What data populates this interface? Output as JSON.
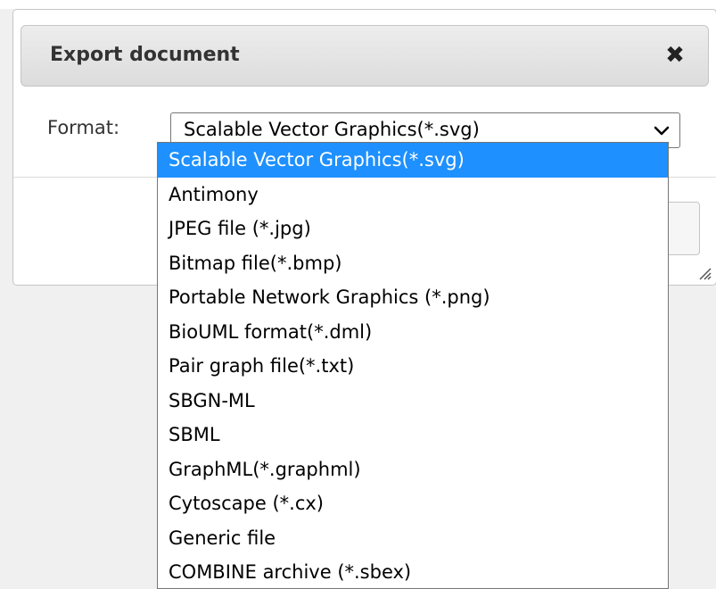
{
  "dialog": {
    "title": "Export document",
    "close_icon": "close-icon"
  },
  "form": {
    "format_label": "Format:",
    "selected_value": "Scalable Vector Graphics(*.svg)",
    "options": [
      "Scalable Vector Graphics(*.svg)",
      "Antimony",
      "JPEG file (*.jpg)",
      "Bitmap file(*.bmp)",
      "Portable Network Graphics (*.png)",
      "BioUML format(*.dml)",
      "Pair graph file(*.txt)",
      "SBGN-ML",
      "SBML",
      "GraphML(*.graphml)",
      "Cytoscape (*.cx)",
      "Generic file",
      "COMBINE archive (*.sbex)"
    ],
    "selected_index": 0
  },
  "colors": {
    "highlight": "#1e90ff",
    "header_bg": "#e4e4e4"
  }
}
